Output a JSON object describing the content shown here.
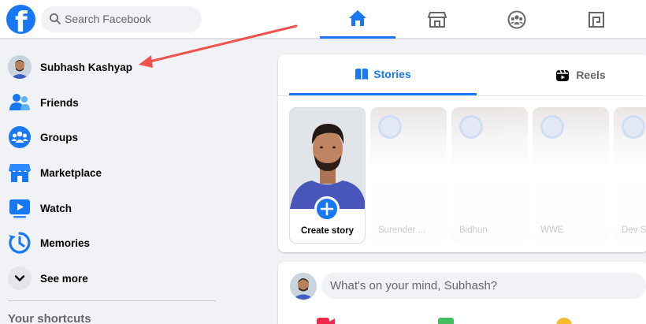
{
  "header": {
    "logo_letter": "f",
    "search_placeholder": "Search Facebook",
    "nav": [
      {
        "name": "home",
        "icon": "home-icon",
        "active": true
      },
      {
        "name": "marketplace",
        "icon": "marketplace-icon",
        "active": false
      },
      {
        "name": "groups",
        "icon": "groups-icon",
        "active": false
      },
      {
        "name": "gaming",
        "icon": "gaming-icon",
        "active": false
      }
    ]
  },
  "sidebar": {
    "profile_name": "Subhash Kashyap",
    "items": [
      {
        "label": "Friends",
        "icon": "friends-icon"
      },
      {
        "label": "Groups",
        "icon": "groups-icon"
      },
      {
        "label": "Marketplace",
        "icon": "marketplace-icon"
      },
      {
        "label": "Watch",
        "icon": "watch-icon"
      },
      {
        "label": "Memories",
        "icon": "memories-icon"
      },
      {
        "label": "See more",
        "icon": "chevron-down-icon"
      }
    ],
    "shortcuts_heading": "Your shortcuts"
  },
  "stories": {
    "tabs": [
      {
        "label": "Stories",
        "icon": "book-icon",
        "active": true
      },
      {
        "label": "Reels",
        "icon": "reels-icon",
        "active": false
      }
    ],
    "create_label": "Create story",
    "cards": [
      "Surender ...",
      "Bidhun",
      "WWE",
      "Dev S"
    ]
  },
  "composer": {
    "placeholder": "What's on your mind, Subhash?"
  },
  "colors": {
    "brand": "#1877f2",
    "annotation_arrow": "#ef5350"
  }
}
